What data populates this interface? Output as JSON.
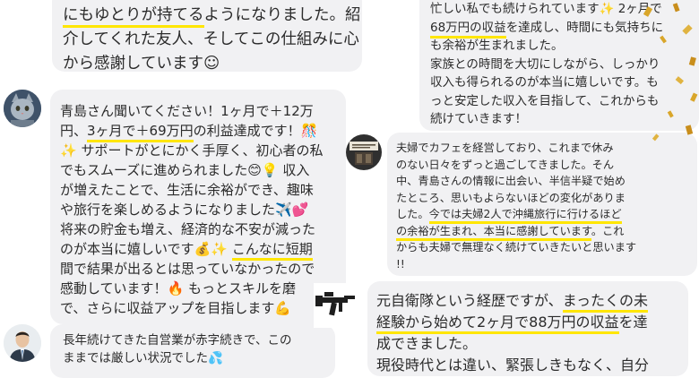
{
  "messages": [
    {
      "lines": [
        {
          "pre": "",
          "hl": "にもゆとりが持てる",
          "post": "ようになりました。紹"
        },
        {
          "pre": "介してくれた友人、そしてこの仕組みに心",
          "hl": "",
          "post": ""
        },
        {
          "pre": "から感謝しています",
          "hl": "",
          "post": "☺"
        }
      ]
    },
    {
      "lines": [
        {
          "pre": "忙しい私でも続けられています✨ 2ヶ月で",
          "hl": "",
          "post": ""
        },
        {
          "pre": "",
          "hl": "68万円の収益",
          "post": "を達成し、時間にも気持ちに"
        },
        {
          "pre": "も余裕が生まれました。",
          "hl": "",
          "post": ""
        },
        {
          "pre": "家族との時間を大切にしながら、しっかり",
          "hl": "",
          "post": ""
        },
        {
          "pre": "収入も得られるのが本当に嬉しいです。も",
          "hl": "",
          "post": ""
        },
        {
          "pre": "っと安定した収入を目指して、これからも",
          "hl": "",
          "post": ""
        },
        {
          "pre": "続けていきます！",
          "hl": "",
          "post": ""
        }
      ]
    },
    {
      "lines": [
        {
          "pre": "青島さん聞いてください！1ヶ月で＋12万",
          "hl": "",
          "post": ""
        },
        {
          "pre": "円、",
          "hl": "3ヶ月で＋69万円",
          "post": "の利益達成です！🎊"
        },
        {
          "pre": "✨ サポートがとにかく手厚く、初心者の私",
          "hl": "",
          "post": ""
        },
        {
          "pre": "でもスムーズに進められました😊💡 収入",
          "hl": "",
          "post": ""
        },
        {
          "pre": "が増えたことで、生活に余裕ができ、趣味",
          "hl": "",
          "post": ""
        },
        {
          "pre": "や旅行を楽しめるようになりました✈️💕",
          "hl": "",
          "post": ""
        },
        {
          "pre": "将来の貯金も増え、経済的な不安が減った",
          "hl": "",
          "post": ""
        },
        {
          "pre": "のが本当に嬉しいです💰✨ ",
          "hl": "こんなに短期",
          "post": ""
        },
        {
          "pre": "間で結果が出るとは思っていなかったので",
          "hl": "",
          "post": ""
        },
        {
          "pre": "感動しています！🔥 もっとスキルを磨",
          "hl": "",
          "post": ""
        },
        {
          "pre": "で、さらに収益アップを目指します💪",
          "hl": "",
          "post": ""
        }
      ]
    },
    {
      "lines": [
        {
          "pre": "夫婦でカフェを経営しており、これまで休み",
          "hl": "",
          "post": ""
        },
        {
          "pre": "のない日々をずっと過ごしてきました。そん",
          "hl": "",
          "post": ""
        },
        {
          "pre": "中、青島さんの情報に出会い、半信半疑で始め",
          "hl": "",
          "post": ""
        },
        {
          "pre": "たところ、思いもよらないほどの変化がありま",
          "hl": "",
          "post": ""
        },
        {
          "pre": "した。",
          "hl": "今では夫婦2人で沖縄旅行に行けるほど",
          "post": ""
        },
        {
          "pre": "",
          "hl": "の余裕が生まれ、本当に感謝しています",
          "post": "。これ"
        },
        {
          "pre": "からも夫婦で無理なく続けていきたいと思います",
          "hl": "",
          "post": ""
        },
        {
          "pre": "!!",
          "hl": "",
          "post": ""
        }
      ]
    },
    {
      "lines": [
        {
          "pre": "元自衛隊という経歴ですが、",
          "hl": "まったくの未",
          "post": ""
        },
        {
          "pre": "",
          "hl": "経験から始めて2ヶ月で88万円の収益",
          "post": "を達"
        },
        {
          "pre": "成できました。",
          "hl": "",
          "post": ""
        },
        {
          "pre": "現役時代とは違い、緊張しきもなく、自分",
          "hl": "",
          "post": ""
        }
      ]
    },
    {
      "lines": [
        {
          "pre": "長年続けてきた自営業が赤字続きで、この",
          "hl": "",
          "post": ""
        },
        {
          "pre": "ままでは厳しい状況でした💦",
          "hl": "",
          "post": ""
        }
      ]
    }
  ],
  "colors": {
    "bubble": "#f1f1f3",
    "highlight": "#ffe600",
    "text": "#2b2b2b",
    "confetti": "#d9a62a"
  },
  "icons": [
    "cat-avatar-icon",
    "cafe-sign-avatar-icon",
    "rifle-avatar-icon",
    "man-suit-avatar-icon"
  ]
}
